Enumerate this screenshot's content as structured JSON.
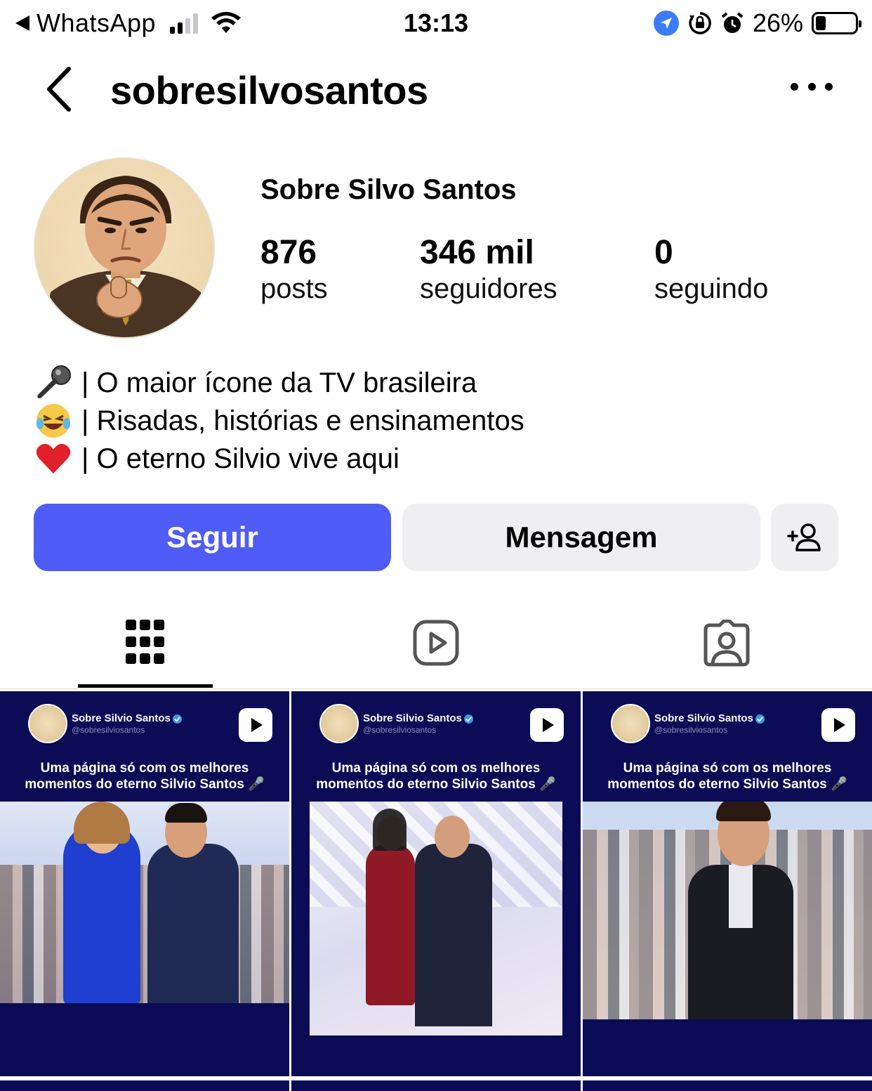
{
  "status_bar": {
    "back_app": "WhatsApp",
    "time": "13:13",
    "battery_percent": "26%",
    "battery_level": 0.26,
    "signal_bars_active": 2,
    "icons": [
      "signal-icon",
      "wifi-icon",
      "location-icon",
      "orientation-lock-icon",
      "alarm-icon",
      "battery-icon"
    ]
  },
  "header": {
    "username": "sobresilvosantos"
  },
  "profile": {
    "display_name": "Sobre Silvo Santos",
    "stats": [
      {
        "value": "876",
        "label": "posts"
      },
      {
        "value": "346 mil",
        "label": "seguidores"
      },
      {
        "value": "0",
        "label": "seguindo"
      }
    ],
    "bio": [
      {
        "icon": "microphone-icon",
        "text": "| O maior ícone da TV brasileira"
      },
      {
        "icon": "laughing-emoji-icon",
        "text": "| Risadas, histórias e ensinamentos"
      },
      {
        "icon": "heart-icon",
        "text": "| O eterno Silvio vive aqui"
      }
    ]
  },
  "actions": {
    "follow": "Seguir",
    "message": "Mensagem"
  },
  "tabs": [
    {
      "icon": "grid-icon",
      "active": true
    },
    {
      "icon": "reels-icon",
      "active": false
    },
    {
      "icon": "tagged-icon",
      "active": false
    }
  ],
  "posts": [
    {
      "account": "Sobre Silvio Santos",
      "handle": "@sobresilviosantos",
      "caption_line1": "Uma página só com os melhores",
      "caption_line2": "momentos do eterno Silvio Santos 🎤"
    },
    {
      "account": "Sobre Silvio Santos",
      "handle": "@sobresilviosantos",
      "caption_line1": "Uma página só com os melhores",
      "caption_line2": "momentos do eterno Silvio Santos 🎤"
    },
    {
      "account": "Sobre Silvio Santos",
      "handle": "@sobresilviosantos",
      "caption_line1": "Uma página só com os melhores",
      "caption_line2": "momentos do eterno Silvio Santos 🎤"
    }
  ],
  "colors": {
    "follow_button": "#4f5cf5",
    "secondary_button": "#efeff1",
    "post_background": "#0b0c55",
    "verified": "#3897f0"
  }
}
